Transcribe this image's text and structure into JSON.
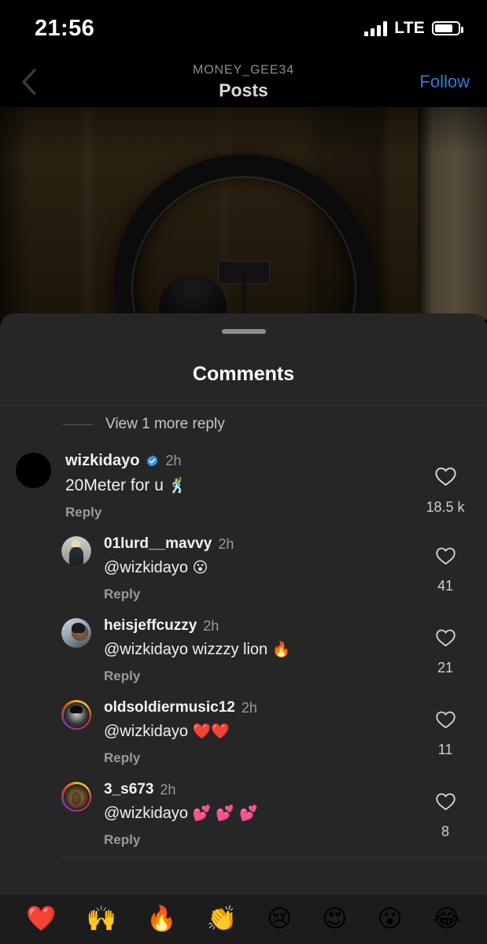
{
  "status_bar": {
    "time": "21:56",
    "network": "LTE",
    "signal_bars": 4,
    "battery_level_pct": 78
  },
  "nav": {
    "back_icon": "chevron-left-icon",
    "account_handle": "MONEY_GEE34",
    "title": "Posts",
    "follow_label": "Follow",
    "follow_color": "#2d7cd6"
  },
  "sheet": {
    "title": "Comments",
    "grabber": "drag-handle",
    "more_replies_label": "View 1 more reply"
  },
  "comments": [
    {
      "username": "wizkidayo",
      "verified": true,
      "time": "2h",
      "text": "20Meter for u",
      "emoji": "🕺",
      "reply_label": "Reply",
      "like_count": "18.5 k",
      "avatar": "plain-black",
      "has_story_ring": false,
      "is_reply": false
    },
    {
      "username": "01lurd__mavvy",
      "verified": false,
      "time": "2h",
      "text": "@wizkidayo",
      "emoji": "😮",
      "reply_label": "Reply",
      "like_count": "41",
      "avatar": "ava-mavvy",
      "has_story_ring": false,
      "is_reply": true
    },
    {
      "username": "heisjeffcuzzy",
      "verified": false,
      "time": "2h",
      "text": "@wizkidayo wizzzy lion",
      "emoji": "🔥",
      "reply_label": "Reply",
      "like_count": "21",
      "avatar": "ava-jeff",
      "has_story_ring": false,
      "is_reply": true
    },
    {
      "username": "oldsoldiermusic12",
      "verified": false,
      "time": "2h",
      "text": "@wizkidayo",
      "emoji": "❤️❤️",
      "reply_label": "Reply",
      "like_count": "11",
      "avatar": "ava-soldier",
      "has_story_ring": true,
      "is_reply": true
    },
    {
      "username": "3_s673",
      "verified": false,
      "time": "2h",
      "text": "@wizkidayo",
      "emoji": "💕 💕 💕",
      "reply_label": "Reply",
      "like_count": "8",
      "avatar": "ava-s673",
      "has_story_ring": true,
      "is_reply": true
    }
  ],
  "emoji_bar": {
    "items": [
      {
        "name": "red-heart",
        "glyph": "❤️"
      },
      {
        "name": "raising-hands",
        "glyph": "🙌"
      },
      {
        "name": "fire",
        "glyph": "🔥"
      },
      {
        "name": "clapping-hands",
        "glyph": "👏"
      },
      {
        "name": "crying-face",
        "glyph": "😢"
      },
      {
        "name": "heart-eyes",
        "glyph": "😍"
      },
      {
        "name": "open-mouth",
        "glyph": "😮"
      },
      {
        "name": "tears-of-joy",
        "glyph": "😂"
      }
    ]
  },
  "colors": {
    "sheet_bg": "#262626",
    "page_bg": "#000000",
    "accent_blue": "#2d7cd6",
    "verified_blue": "#3797f0"
  }
}
